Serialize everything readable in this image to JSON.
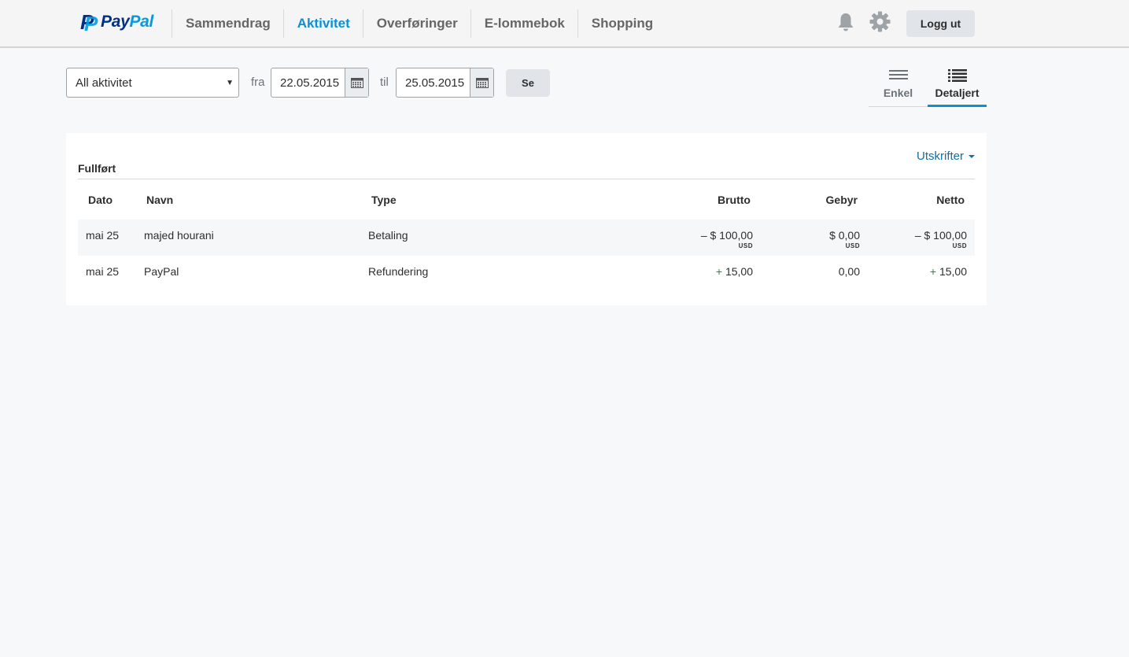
{
  "brand": {
    "p_letter": "P",
    "word_part1": "Pay",
    "word_part2": "Pal"
  },
  "nav": {
    "items": [
      {
        "label": "Sammendrag",
        "active": false
      },
      {
        "label": "Aktivitet",
        "active": true
      },
      {
        "label": "Overføringer",
        "active": false
      },
      {
        "label": "E-lommebok",
        "active": false
      },
      {
        "label": "Shopping",
        "active": false
      }
    ]
  },
  "header_actions": {
    "bell_icon": "bell-icon",
    "gear_icon": "gear-icon",
    "logout_label": "Logg ut"
  },
  "filter": {
    "activity_value": "All aktivitet",
    "from_label": "fra",
    "from_date": "22.05.2015",
    "to_label": "til",
    "to_date": "25.05.2015",
    "submit_label": "Se"
  },
  "view_toggle": {
    "simple_label": "Enkel",
    "detailed_label": "Detaljert",
    "active": "detailed"
  },
  "activity": {
    "print_label": "Utskrifter",
    "section_title": "Fullført",
    "columns": {
      "date": "Dato",
      "name": "Navn",
      "type": "Type",
      "gross": "Brutto",
      "fee": "Gebyr",
      "net": "Netto"
    },
    "rows": [
      {
        "date": "mai 25",
        "name": "majed hourani",
        "type": "Betaling",
        "gross_sign": "– ",
        "gross": "$ 100,00",
        "gross_currency": "USD",
        "fee": "$ 0,00",
        "fee_currency": "USD",
        "net_sign": "– ",
        "net": "$ 100,00",
        "net_currency": "USD"
      },
      {
        "date": "mai 25",
        "name": "PayPal",
        "type": "Refundering",
        "gross_sign": "+ ",
        "gross": "15,00",
        "fee": "0,00",
        "net_sign": "+ ",
        "net": "15,00"
      }
    ]
  },
  "colors": {
    "accent": "#0f8fd1",
    "link": "#0f6fa8",
    "positive": "#2a8a3e",
    "brand_dark": "#003087",
    "brand_light": "#009cde"
  }
}
